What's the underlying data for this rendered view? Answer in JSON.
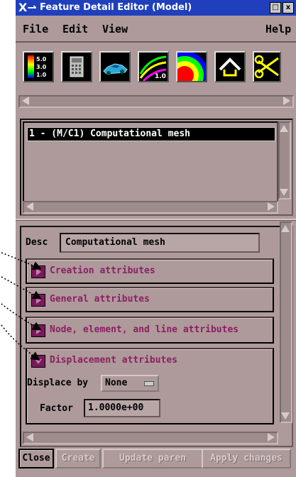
{
  "window": {
    "title": "Feature Detail Editor (Model)",
    "close_btn": "x",
    "minimize_btn": "□",
    "colors": {
      "titlebar": "#1f3fbd",
      "background": "#ae9a9a",
      "accent": "#8c1e64"
    }
  },
  "menu": {
    "file": "File",
    "edit": "Edit",
    "view": "View",
    "help": "Help"
  },
  "toolbar": {
    "tools": [
      {
        "icon": "color-scale-icon",
        "labels": [
          "5.0",
          "3.0",
          "1.0"
        ]
      },
      {
        "icon": "calculator-icon"
      },
      {
        "icon": "car-model-icon"
      },
      {
        "icon": "line-contour-icon",
        "label": "1.0"
      },
      {
        "icon": "rainbow-contour-icon"
      },
      {
        "icon": "house-outline-icon"
      },
      {
        "icon": "scissors-icon"
      }
    ]
  },
  "list": {
    "items": [
      "1 - (M/C1) Computational mesh"
    ]
  },
  "details": {
    "desc_label": "Desc",
    "desc_value": "Computational mesh",
    "groups": [
      {
        "label": "Creation attributes",
        "expanded": false
      },
      {
        "label": "General attributes",
        "expanded": false
      },
      {
        "label": "Node, element, and line attributes",
        "expanded": false
      },
      {
        "label": "Displacement attributes",
        "expanded": true
      }
    ],
    "displace_by_label": "Displace by",
    "displace_by_value": "None",
    "factor_label": "Factor",
    "factor_value": "1.0000e+00"
  },
  "buttons": {
    "close": "Close",
    "create": "Create",
    "update": "Update paren",
    "apply": "Apply changes"
  }
}
